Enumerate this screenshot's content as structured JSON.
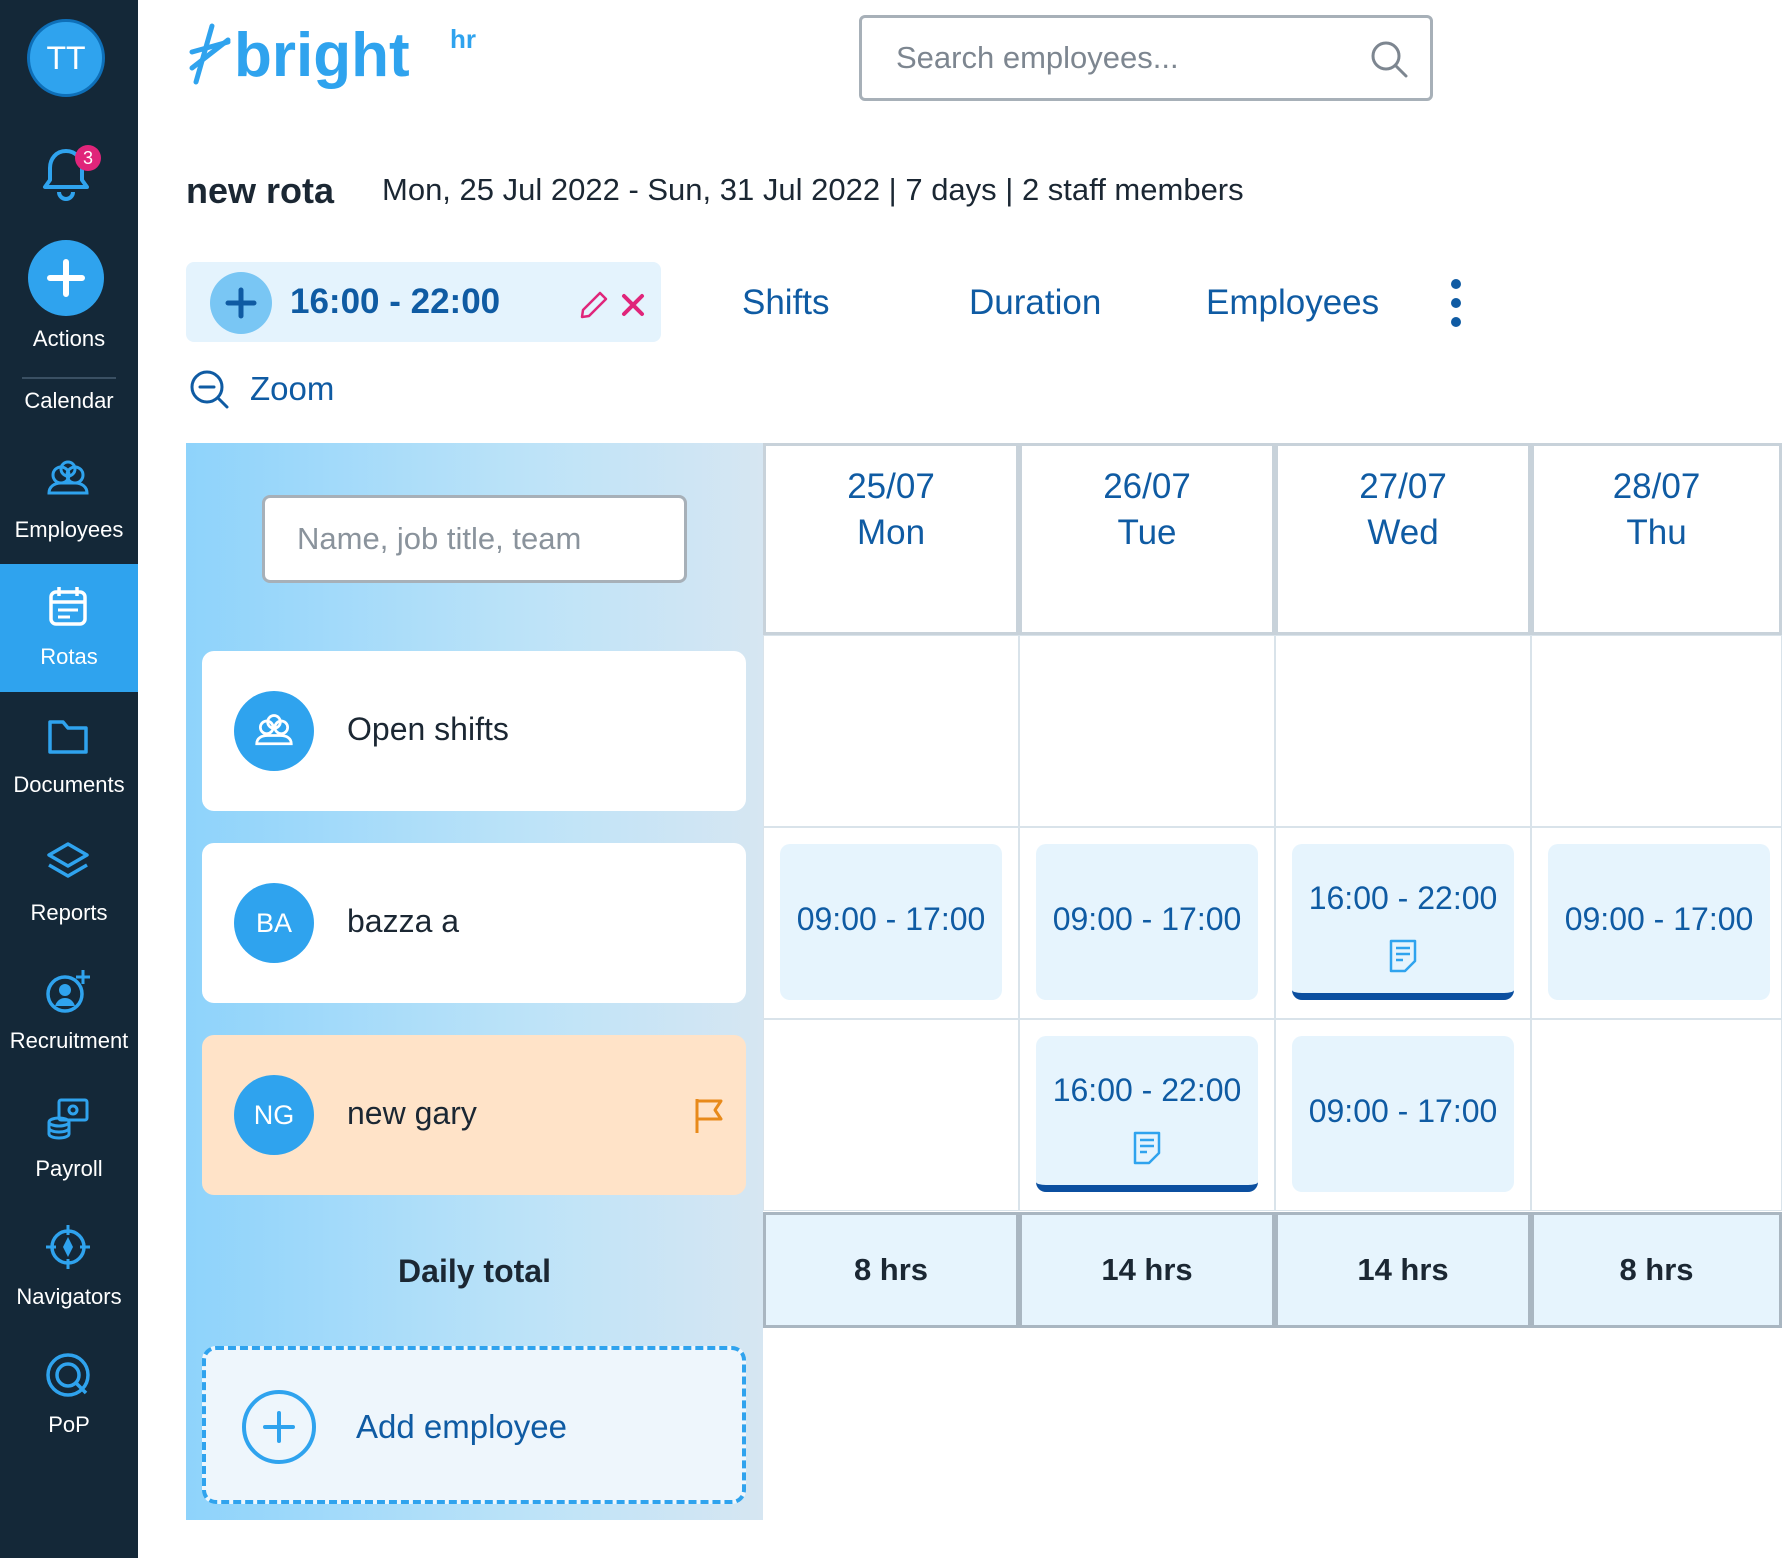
{
  "user": {
    "initials": "TT"
  },
  "notifications": {
    "count": "3"
  },
  "sidebar": {
    "actions_label": "Actions",
    "calendar_label": "Calendar",
    "items": [
      {
        "label": "Employees",
        "icon": "team-icon"
      },
      {
        "label": "Rotas",
        "icon": "calendar-icon",
        "active": true
      },
      {
        "label": "Documents",
        "icon": "folder-icon"
      },
      {
        "label": "Reports",
        "icon": "layers-icon"
      },
      {
        "label": "Recruitment",
        "icon": "add-user-icon"
      },
      {
        "label": "Payroll",
        "icon": "payroll-icon"
      },
      {
        "label": "Navigators",
        "icon": "compass-icon"
      },
      {
        "label": "PoP",
        "icon": "target-icon"
      }
    ]
  },
  "brand": {
    "name": "bright",
    "suffix": "hr",
    "color": "#2fa3ee"
  },
  "search": {
    "placeholder": "Search employees..."
  },
  "rota": {
    "title": "new rota",
    "summary": "Mon, 25 Jul 2022 - Sun, 31 Jul 2022 | 7 days | 2 staff members"
  },
  "shift_chip": {
    "time": "16:00 - 22:00"
  },
  "tabs": [
    "Shifts",
    "Duration",
    "Employees"
  ],
  "zoom_label": "Zoom",
  "filter": {
    "placeholder": "Name, job title, team"
  },
  "rows": [
    {
      "initials": "",
      "name": "Open shifts"
    },
    {
      "initials": "BA",
      "name": "bazza a"
    },
    {
      "initials": "NG",
      "name": "new gary"
    }
  ],
  "days": [
    {
      "date": "25/07",
      "day": "Mon"
    },
    {
      "date": "26/07",
      "day": "Tue"
    },
    {
      "date": "27/07",
      "day": "Wed"
    },
    {
      "date": "28/07",
      "day": "Thu"
    }
  ],
  "shifts": {
    "bazza": [
      "09:00 - 17:00",
      "09:00 - 17:00",
      "16:00 - 22:00",
      "09:00 - 17:00"
    ],
    "gary": [
      "",
      "16:00 - 22:00",
      "09:00 - 17:00",
      ""
    ]
  },
  "daily_total": {
    "label": "Daily total",
    "values": [
      "8 hrs",
      "14 hrs",
      "14 hrs",
      "8 hrs"
    ]
  },
  "add_employee_label": "Add employee",
  "colors": {
    "sidebar": "#142838",
    "accent": "#2fa3ee",
    "link": "#0f5ba3",
    "alert": "#e0257a",
    "flag": "#e88a1a"
  }
}
